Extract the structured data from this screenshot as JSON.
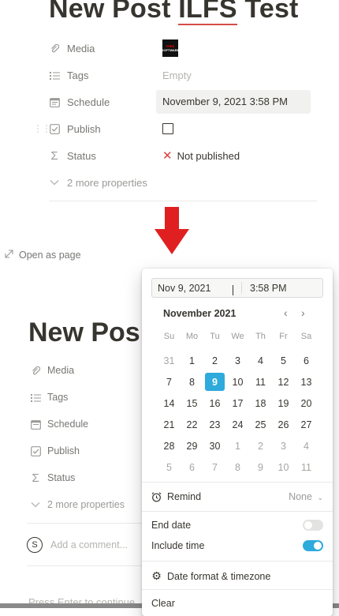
{
  "top_page": {
    "title_prefix": "New Post ",
    "title_flagged": "ILFS",
    "title_suffix": " Test",
    "properties": [
      {
        "icon": "paperclip-icon",
        "name": "Media",
        "value": "thumbnail"
      },
      {
        "icon": "list-icon",
        "name": "Tags",
        "value": "Empty"
      },
      {
        "icon": "calendar-icon",
        "name": "Schedule",
        "value": "November 9, 2021 3:58 PM"
      },
      {
        "icon": "checkbox-icon",
        "name": "Publish",
        "value": "checkbox"
      },
      {
        "icon": "sigma-icon",
        "name": "Status",
        "value": "Not published"
      }
    ],
    "more_properties": "2 more properties",
    "thumbnail_text": [
      "FREE",
      "SOFTWARE"
    ]
  },
  "bottom_page": {
    "open_as_page": "Open as page",
    "title": "New Pos",
    "properties": [
      "Media",
      "Tags",
      "Schedule",
      "Publish",
      "Status"
    ],
    "more_properties": "2 more properties",
    "comment_avatar": "S",
    "comment_placeholder": "Add a comment...",
    "press_enter": "Press Enter to continue"
  },
  "date_popup": {
    "date_value": "Nov 9, 2021",
    "time_value": "3:58 PM",
    "month_label": "November 2021",
    "prev": "‹",
    "next": "›",
    "weekdays": [
      "Su",
      "Mo",
      "Tu",
      "We",
      "Th",
      "Fr",
      "Sa"
    ],
    "weeks": [
      [
        "31",
        "1",
        "2",
        "3",
        "4",
        "5",
        "6"
      ],
      [
        "7",
        "8",
        "9",
        "10",
        "11",
        "12",
        "13"
      ],
      [
        "14",
        "15",
        "16",
        "17",
        "18",
        "19",
        "20"
      ],
      [
        "21",
        "22",
        "23",
        "24",
        "25",
        "26",
        "27"
      ],
      [
        "28",
        "29",
        "30",
        "1",
        "2",
        "3",
        "4"
      ],
      [
        "5",
        "6",
        "7",
        "8",
        "9",
        "10",
        "11"
      ]
    ],
    "selected_day": "9",
    "remind_label": "Remind",
    "remind_value": "None",
    "end_date_label": "End date",
    "end_date_on": false,
    "include_time_label": "Include time",
    "include_time_on": true,
    "date_format_label": "Date format & timezone",
    "clear_label": "Clear"
  },
  "colors": {
    "accent": "#2eaadc",
    "arrow": "#e02020",
    "error": "#e03e3e"
  }
}
